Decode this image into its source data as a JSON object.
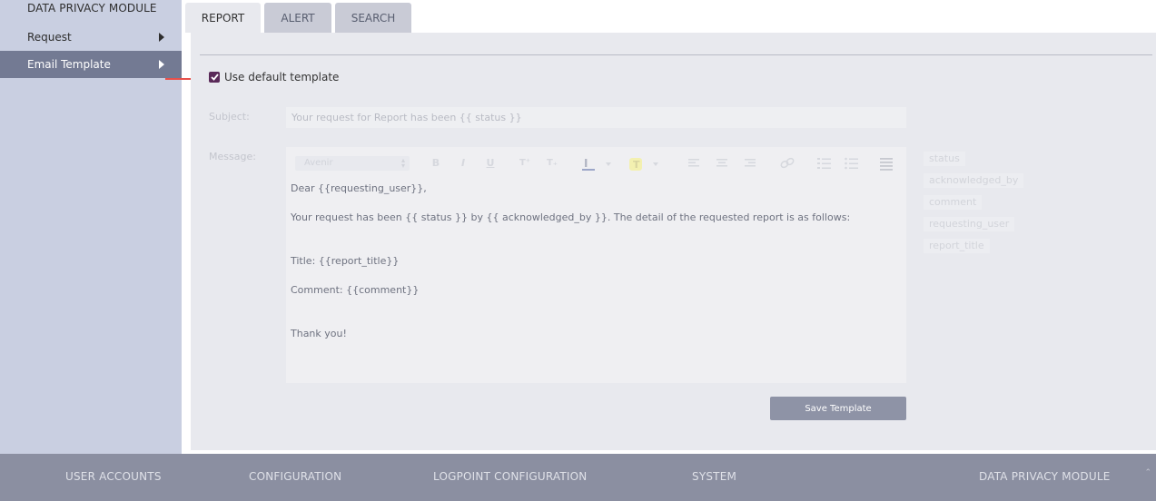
{
  "sidebar": {
    "title": "DATA PRIVACY MODULE",
    "items": [
      {
        "label": "Request"
      },
      {
        "label": "Email Template"
      }
    ]
  },
  "tabs": [
    {
      "label": "REPORT"
    },
    {
      "label": "ALERT"
    },
    {
      "label": "SEARCH"
    }
  ],
  "form": {
    "use_default_label": "Use default template",
    "use_default_checked": true,
    "subject_label": "Subject:",
    "subject_placeholder": "Your request for Report has been {{ status }}",
    "message_label": "Message:",
    "font_name": "Avenir",
    "message_lines": [
      "Dear {{requesting_user}},",
      "Your request has been {{ status }} by {{ acknowledged_by }}. The detail of the requested report is as follows:",
      "Title: {{report_title}}",
      "Comment: {{comment}}",
      "Thank you!"
    ],
    "variables": [
      "status",
      "acknowledged_by",
      "comment",
      "requesting_user",
      "report_title"
    ],
    "save_label": "Save Template"
  },
  "toolbar": {
    "bold": "B",
    "italic": "I",
    "underline": "U",
    "superscript": "T⁺",
    "subscript": "T₊"
  },
  "footer": {
    "items": [
      "USER ACCOUNTS",
      "CONFIGURATION",
      "LOGPOINT CONFIGURATION",
      "SYSTEM",
      "DATA PRIVACY MODULE"
    ]
  },
  "colors": {
    "sidebar_bg": "#c9cfe1",
    "sidebar_active": "#737a93",
    "checkbox": "#5a2a59",
    "footer_bg": "#8b8fa1",
    "save_button": "#8e93a6",
    "annotation_arrow": "#e8504a"
  }
}
